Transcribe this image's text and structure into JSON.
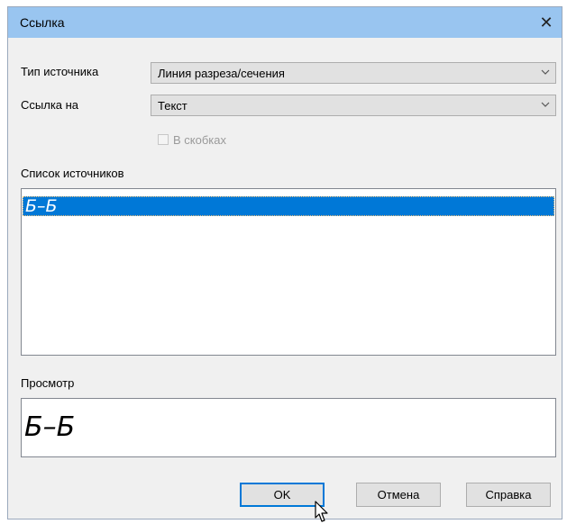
{
  "window": {
    "title": "Ссылка",
    "close_glyph": "✕"
  },
  "form": {
    "source_type_label": "Тип источника",
    "source_type_value": "Линия разреза/сечения",
    "reference_label": "Ссылка на",
    "reference_value": "Текст",
    "brackets_label": "В скобках",
    "brackets_checked": false,
    "brackets_enabled": false
  },
  "sources": {
    "label": "Список источников",
    "items": [
      {
        "text": "Б–Б",
        "selected": true
      }
    ]
  },
  "preview": {
    "label": "Просмотр",
    "text": "Б–Б"
  },
  "buttons": {
    "ok": "OK",
    "cancel": "Отмена",
    "help": "Справка"
  },
  "colors": {
    "titlebar": "#99c5f0",
    "selection": "#0078d7",
    "dialog_bg": "#f0f0f0"
  },
  "icons": [
    "close-icon",
    "chevron-down-icon",
    "mouse-cursor-icon"
  ]
}
